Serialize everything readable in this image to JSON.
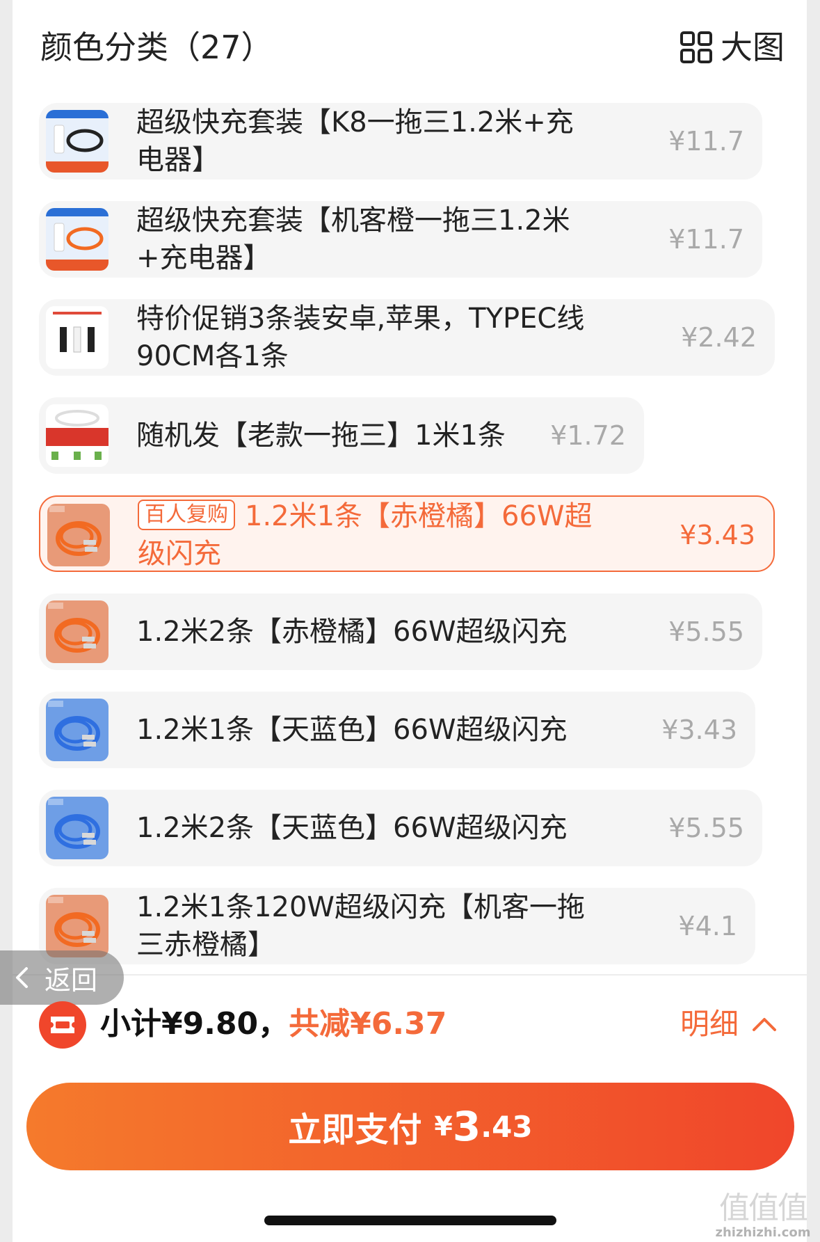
{
  "header": {
    "title": "颜色分类（27）",
    "bigview_icon": "grid-icon",
    "bigview_label": "大图"
  },
  "items": [
    {
      "name": "超级快充套装【K8一拖三1.2米+充电器】",
      "price": "¥11.7",
      "badge": "",
      "selected": false,
      "thumb": "charger-kit-black-cable"
    },
    {
      "name": "超级快充套装【机客橙一拖三1.2米+充电器】",
      "price": "¥11.7",
      "badge": "",
      "selected": false,
      "thumb": "charger-kit-orange-cable"
    },
    {
      "name": "特价促销3条装安卓,苹果，TYPEC线90CM各1条",
      "price": "¥2.42",
      "badge": "",
      "selected": false,
      "thumb": "three-cables-pack"
    },
    {
      "name": "随机发【老款一拖三】1米1条",
      "price": "¥1.72",
      "badge": "",
      "selected": false,
      "thumb": "random-old-cable"
    },
    {
      "name": "1.2米1条【赤橙橘】66W超级闪充",
      "price": "¥3.43",
      "badge": "百人复购",
      "selected": true,
      "thumb": "orange-cable"
    },
    {
      "name": "1.2米2条【赤橙橘】66W超级闪充",
      "price": "¥5.55",
      "badge": "",
      "selected": false,
      "thumb": "orange-cable"
    },
    {
      "name": "1.2米1条【天蓝色】66W超级闪充",
      "price": "¥3.43",
      "badge": "",
      "selected": false,
      "thumb": "blue-cable"
    },
    {
      "name": "1.2米2条【天蓝色】66W超级闪充",
      "price": "¥5.55",
      "badge": "",
      "selected": false,
      "thumb": "blue-cable"
    },
    {
      "name": "1.2米1条120W超级闪充【机客一拖三赤橙橘】",
      "price": "¥4.1",
      "badge": "",
      "selected": false,
      "thumb": "orange-cable"
    }
  ],
  "back": {
    "icon": "chevron-left-icon",
    "label": "返回"
  },
  "summary": {
    "coupon_icon": "coupon-ticket-icon",
    "subtotal": "小计¥9.80，",
    "discount": "共减¥6.37",
    "detail_label": "明细",
    "detail_icon": "chevron-up-icon"
  },
  "pay": {
    "label": "立即支付",
    "currency": "¥",
    "amount_int": "3",
    "amount_dec": ".43"
  },
  "watermark": {
    "glyphs": "值值值",
    "url": "zhizhizhi.com"
  },
  "colors": {
    "accent": "#f46a3a",
    "pay_start": "#f57a2c",
    "pay_end": "#f0462b",
    "price_muted": "#a9a9a9",
    "item_bg": "#f5f5f5"
  }
}
